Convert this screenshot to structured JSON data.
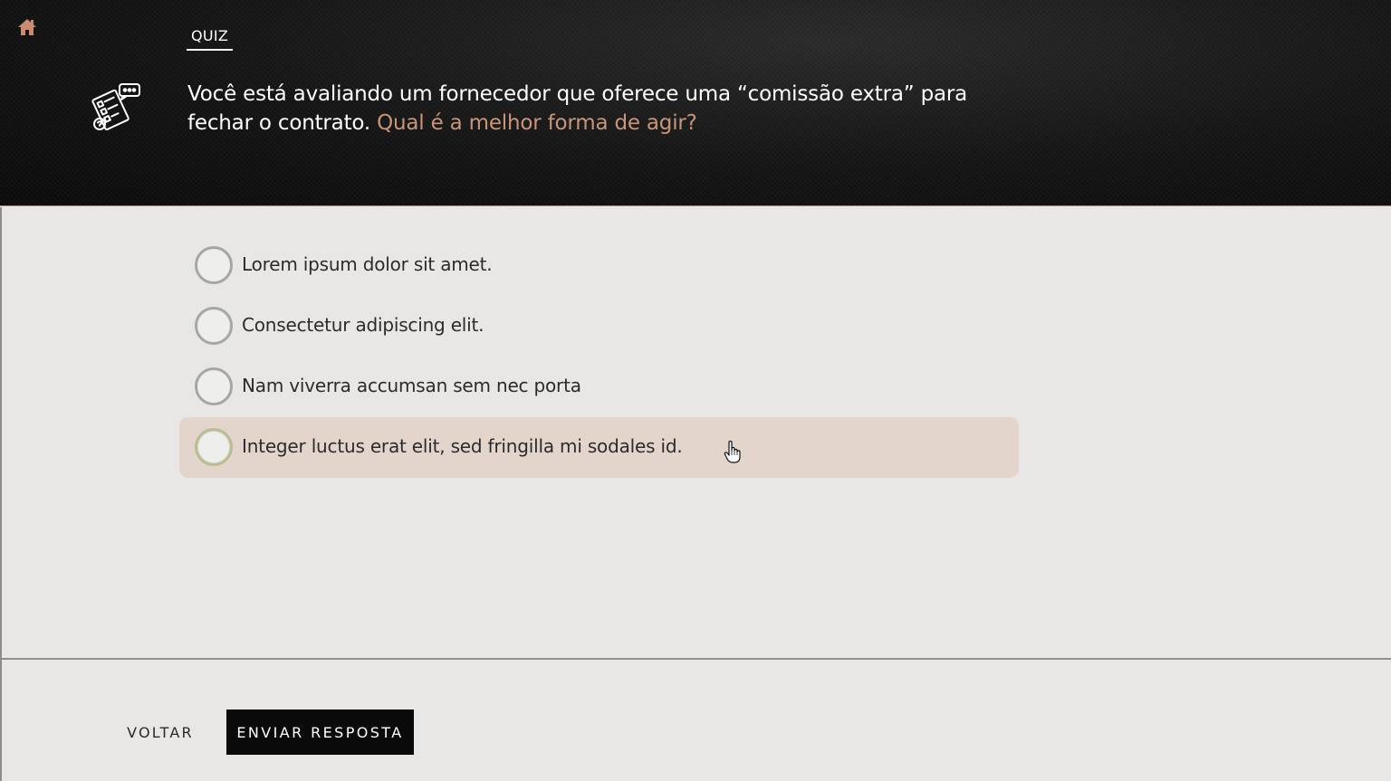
{
  "header": {
    "home_icon": "home-icon",
    "tab_label": "QUIZ",
    "illustration_icon": "checklist-chat-icon",
    "question_main": "Você está avaliando um fornecedor que oferece uma “comissão extra” para fechar o contrato.",
    "question_accent": "Qual é a melhor forma de agir?",
    "accent_color": "#c99578"
  },
  "options": [
    {
      "label": "Lorem ipsum dolor sit amet."
    },
    {
      "label": "Consectetur adipiscing elit."
    },
    {
      "label": "Nam viverra accumsan sem nec porta"
    },
    {
      "label": "Integer luctus erat elit, sed fringilla mi sodales id."
    }
  ],
  "footer": {
    "back_label": "VOLTAR",
    "submit_label": "ENVIAR RESPOSTA"
  }
}
